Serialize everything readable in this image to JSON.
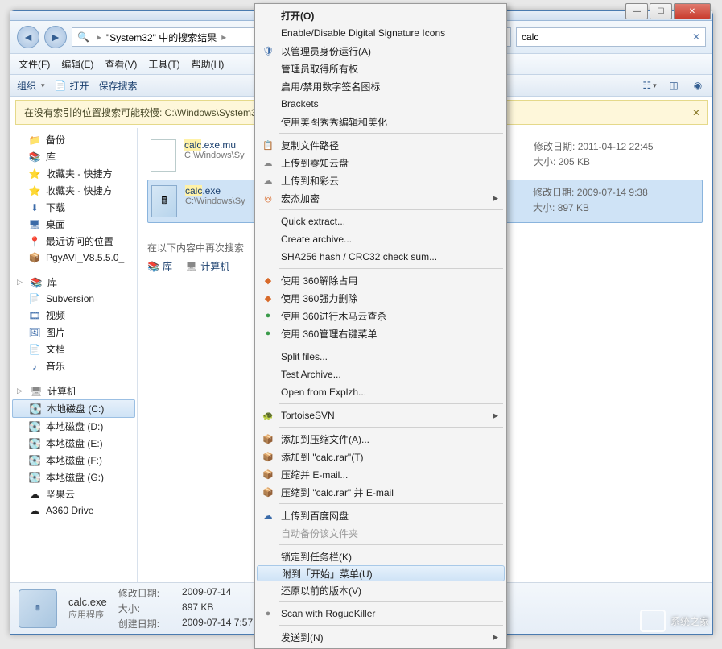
{
  "window": {
    "breadcrumb_text": "\"System32\"  中的搜索结果",
    "search_value": "calc"
  },
  "menubar": {
    "file": "文件(F)",
    "edit": "编辑(E)",
    "view": "查看(V)",
    "tools": "工具(T)",
    "help": "帮助(H)"
  },
  "toolbar": {
    "organize": "组织",
    "open": "打开",
    "save_search": "保存搜索"
  },
  "info_strip": {
    "text": "在没有索引的位置搜索可能较慢: C:\\Windows\\System3"
  },
  "nav": {
    "group1": [
      {
        "icon": "📁",
        "label": "备份",
        "color": "c-gold"
      },
      {
        "icon": "📚",
        "label": "库",
        "color": "c-blue"
      },
      {
        "icon": "⭐",
        "label": "收藏夹 - 快捷方",
        "color": "c-gold"
      },
      {
        "icon": "⭐",
        "label": "收藏夹 - 快捷方",
        "color": "c-gold"
      },
      {
        "icon": "⬇",
        "label": "下载",
        "color": "c-blue"
      },
      {
        "icon": "🖥",
        "label": "桌面",
        "color": "c-blue"
      },
      {
        "icon": "📍",
        "label": "最近访问的位置",
        "color": "c-orange"
      },
      {
        "icon": "📦",
        "label": "PgyAVI_V8.5.5.0_",
        "color": ""
      }
    ],
    "group2_header": "库",
    "group2": [
      {
        "icon": "📄",
        "label": "Subversion",
        "color": "c-blue"
      },
      {
        "icon": "🎞",
        "label": "视频",
        "color": "c-blue"
      },
      {
        "icon": "🖼",
        "label": "图片",
        "color": "c-blue"
      },
      {
        "icon": "📄",
        "label": "文档",
        "color": "c-blue"
      },
      {
        "icon": "♪",
        "label": "音乐",
        "color": "c-blue"
      }
    ],
    "group3_header": "计算机",
    "group3": [
      {
        "icon": "💽",
        "label": "本地磁盘 (C:)",
        "selected": true
      },
      {
        "icon": "💽",
        "label": "本地磁盘 (D:)"
      },
      {
        "icon": "💽",
        "label": "本地磁盘 (E:)"
      },
      {
        "icon": "💽",
        "label": "本地磁盘 (F:)"
      },
      {
        "icon": "💽",
        "label": "本地磁盘 (G:)"
      },
      {
        "icon": "☁",
        "label": "坚果云"
      },
      {
        "icon": "☁",
        "label": "A360 Drive"
      }
    ]
  },
  "results": [
    {
      "name_prefix": "calc",
      "name_suffix": ".exe.mu",
      "path": "C:\\Windows\\Sy",
      "meta_date_label": "修改日期:",
      "meta_date": "2011-04-12 22:45",
      "meta_size_label": "大小:",
      "meta_size": "205 KB",
      "selected": false,
      "calc": false
    },
    {
      "name_prefix": "calc",
      "name_suffix": ".exe",
      "path": "C:\\Windows\\Sy",
      "meta_date_label": "修改日期:",
      "meta_date": "2009-07-14 9:38",
      "meta_size_label": "大小:",
      "meta_size": "897 KB",
      "selected": true,
      "calc": true
    }
  ],
  "search_again": {
    "label": "在以下内容中再次搜索",
    "lib": "库",
    "computer": "计算机"
  },
  "details": {
    "name": "calc.exe",
    "type_label": "应用程序",
    "mod_label": "修改日期:",
    "mod": "2009-07-14",
    "size_label": "大小:",
    "size": "897 KB",
    "created_label": "创建日期:",
    "created": "2009-07-14 7:57"
  },
  "watermark": "系统之家",
  "context_menu": {
    "groups": [
      [
        {
          "label": "打开(O)",
          "bold": true
        },
        {
          "label": "Enable/Disable Digital Signature Icons"
        },
        {
          "label": "以管理员身份运行(A)",
          "icon": "🛡",
          "ic": "c-blue"
        },
        {
          "label": "管理员取得所有权"
        },
        {
          "label": "启用/禁用数字签名图标"
        },
        {
          "label": "Brackets"
        },
        {
          "label": "使用美图秀秀编辑和美化"
        }
      ],
      [
        {
          "label": "复制文件路径",
          "icon": "📋",
          "ic": "c-gray"
        },
        {
          "label": "上传到零知云盘",
          "icon": "☁",
          "ic": "c-gray"
        },
        {
          "label": "上传到和彩云",
          "icon": "☁",
          "ic": "c-gray"
        },
        {
          "label": "宏杰加密",
          "icon": "◎",
          "ic": "c-orange",
          "submenu": true
        }
      ],
      [
        {
          "label": "Quick extract..."
        },
        {
          "label": "Create archive..."
        },
        {
          "label": "SHA256 hash / CRC32 check sum..."
        }
      ],
      [
        {
          "label": "使用 360解除占用",
          "icon": "◆",
          "ic": "c-orange"
        },
        {
          "label": "使用 360强力删除",
          "icon": "◆",
          "ic": "c-orange"
        },
        {
          "label": "使用 360进行木马云查杀",
          "icon": "●",
          "ic": "c-green"
        },
        {
          "label": "使用 360管理右键菜单",
          "icon": "●",
          "ic": "c-green"
        }
      ],
      [
        {
          "label": "Split files..."
        },
        {
          "label": "Test Archive..."
        },
        {
          "label": "Open from Explzh..."
        }
      ],
      [
        {
          "label": "TortoiseSVN",
          "icon": "🐢",
          "ic": "c-blue",
          "submenu": true
        }
      ],
      [
        {
          "label": "添加到压缩文件(A)...",
          "icon": "📦",
          "ic": "c-purple"
        },
        {
          "label": "添加到 \"calc.rar\"(T)",
          "icon": "📦",
          "ic": "c-purple"
        },
        {
          "label": "压缩并 E-mail...",
          "icon": "📦",
          "ic": "c-purple"
        },
        {
          "label": "压缩到 \"calc.rar\" 并 E-mail",
          "icon": "📦",
          "ic": "c-purple"
        }
      ],
      [
        {
          "label": "上传到百度网盘",
          "icon": "☁",
          "ic": "c-blue"
        },
        {
          "label": "自动备份该文件夹",
          "disabled": true
        }
      ],
      [
        {
          "label": "锁定到任务栏(K)"
        },
        {
          "label": "附到「开始」菜单(U)",
          "highlight": true
        },
        {
          "label": "还原以前的版本(V)"
        }
      ],
      [
        {
          "label": "Scan with RogueKiller",
          "icon": "●",
          "ic": "c-gray"
        }
      ],
      [
        {
          "label": "发送到(N)",
          "submenu": true
        }
      ]
    ]
  }
}
